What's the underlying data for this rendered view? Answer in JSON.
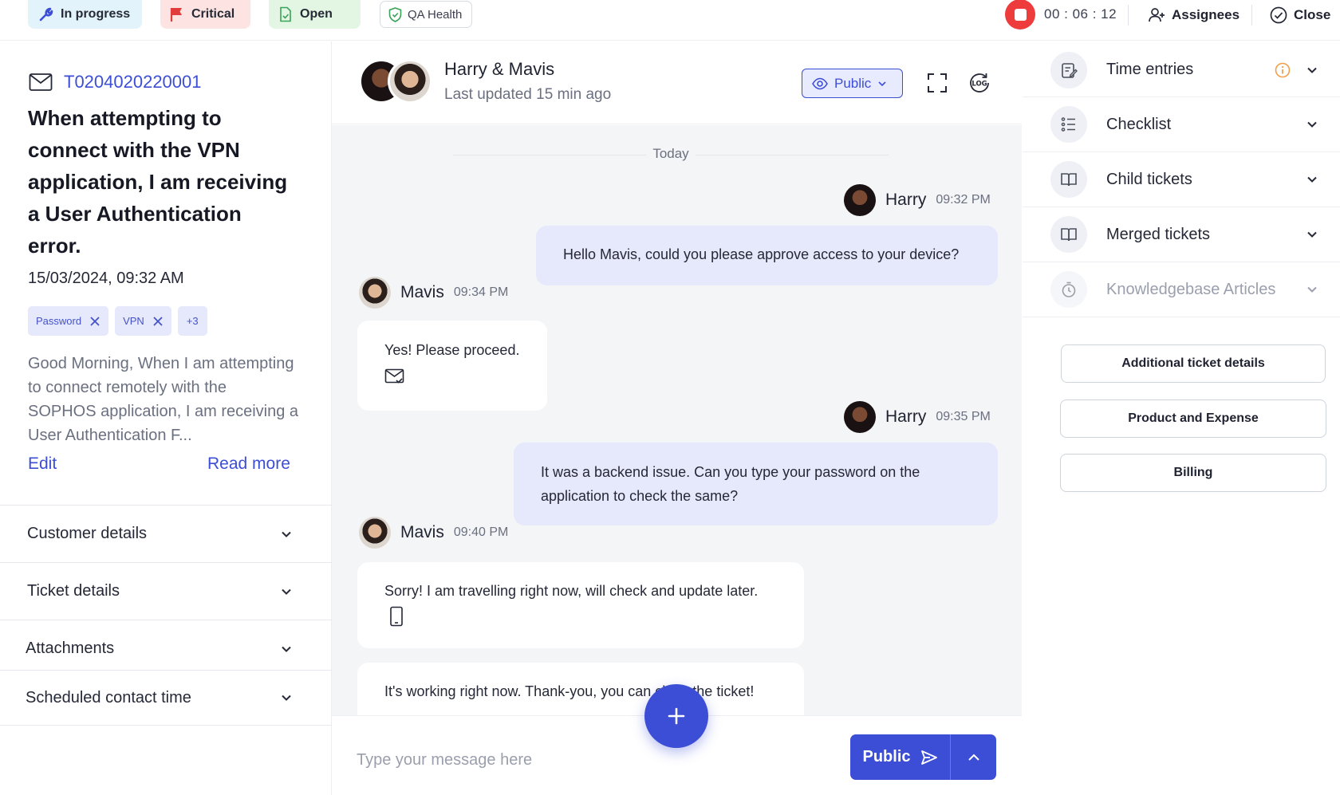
{
  "topbar": {
    "status_in_progress": "In progress",
    "priority_critical": "Critical",
    "state_open": "Open",
    "qa_health": "QA Health",
    "timer": "00 : 06 : 12",
    "assignees": "Assignees",
    "close": "Close"
  },
  "ticket": {
    "id": "T0204020220001",
    "subject": "When attempting to connect with the VPN application, I am receiving a User Authentication error.",
    "datetime": "15/03/2024, 09:32 AM",
    "tags": [
      "Password",
      "VPN"
    ],
    "more_tags": "+3",
    "description": "Good Morning,  When I am attempting to connect remotely with the SOPHOS application, I am receiving a User Authentication F...",
    "edit": "Edit",
    "read_more": "Read more"
  },
  "left_sections": [
    "Customer details",
    "Ticket details",
    "Attachments",
    "Scheduled contact time"
  ],
  "chat": {
    "title": "Harry & Mavis",
    "subtitle": "Last updated 15 min ago",
    "visibility": "Public",
    "day_label": "Today",
    "messages": [
      {
        "sender": "Harry",
        "time": "09:32 PM",
        "text": "Hello Mavis, could you please approve access to your device?"
      },
      {
        "sender": "Mavis",
        "time": "09:34 PM",
        "text": "Yes! Please proceed."
      },
      {
        "sender": "Harry",
        "time": "09:35 PM",
        "text": "It was a backend issue. Can you type your password on the application to check the same?"
      },
      {
        "sender": "Mavis",
        "time": "09:40 PM",
        "text": "Sorry! I am travelling right now, will check and update later."
      },
      {
        "sender": "Mavis",
        "time": "",
        "text": "It's working right now. Thank-you, you can close the ticket!"
      }
    ],
    "composer_placeholder": "Type your message here",
    "send_label": "Public"
  },
  "right_panel": {
    "sections": [
      "Time entries",
      "Checklist",
      "Child tickets",
      "Merged tickets",
      "Knowledgebase Articles"
    ],
    "buttons": [
      "Additional ticket details",
      "Product and Expense",
      "Billing"
    ]
  },
  "colors": {
    "accent": "#3d4ed6",
    "record": "#ee3b3b",
    "warning": "#f0a04b",
    "critical_flag": "#e23b3b",
    "open_icon": "#3aa35a"
  },
  "icons": [
    "wrench-icon",
    "flag-icon",
    "file-check-icon",
    "shield-icon",
    "stop-record-icon",
    "user-icon",
    "check-circle-icon",
    "mail-icon",
    "close-icon",
    "chevron-down-icon",
    "eye-icon",
    "fullscreen-icon",
    "log-icon",
    "mail-check-icon",
    "phone-icon",
    "plus-icon",
    "send-icon",
    "chevron-up-icon",
    "notes-icon",
    "list-icon",
    "book-icon",
    "timer-icon",
    "info-icon"
  ]
}
